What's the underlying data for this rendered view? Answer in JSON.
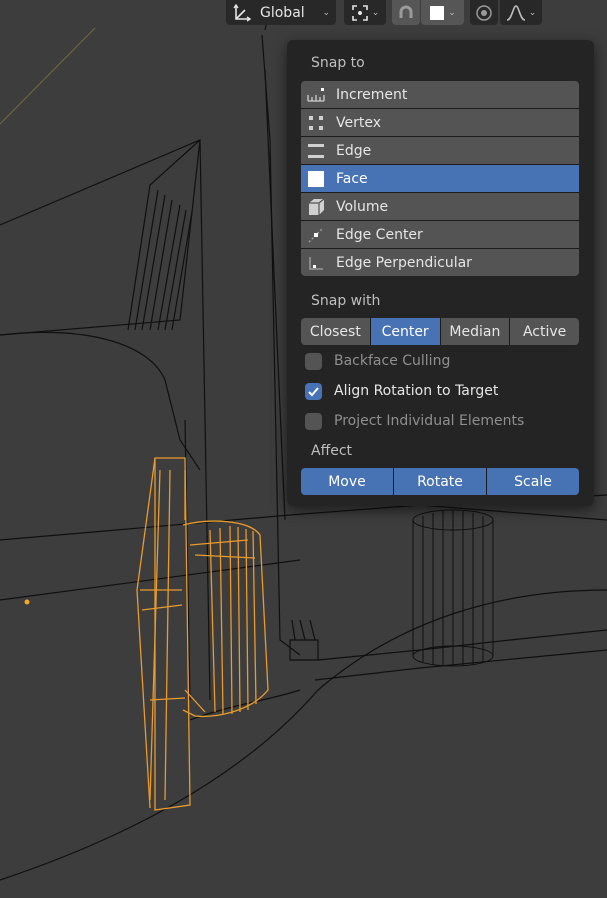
{
  "header": {
    "orientation_label": "Global",
    "snap_element_swatch_color": "#ffffff"
  },
  "snap_popover": {
    "snap_to_title": "Snap to",
    "snap_to_items": [
      {
        "label": "Increment",
        "icon": "increment-icon"
      },
      {
        "label": "Vertex",
        "icon": "vertex-icon"
      },
      {
        "label": "Edge",
        "icon": "edge-icon"
      },
      {
        "label": "Face",
        "icon": "face-icon"
      },
      {
        "label": "Volume",
        "icon": "volume-icon"
      },
      {
        "label": "Edge Center",
        "icon": "edge-center-icon"
      },
      {
        "label": "Edge Perpendicular",
        "icon": "edge-perpendicular-icon"
      }
    ],
    "snap_to_selected": "Face",
    "snap_with_title": "Snap with",
    "snap_with_options": [
      "Closest",
      "Center",
      "Median",
      "Active"
    ],
    "snap_with_selected": "Center",
    "options": [
      {
        "label": "Backface Culling",
        "checked": false
      },
      {
        "label": "Align Rotation to Target",
        "checked": true
      },
      {
        "label": "Project Individual Elements",
        "checked": false
      }
    ],
    "affect_title": "Affect",
    "affect_options": [
      "Move",
      "Rotate",
      "Scale"
    ],
    "affect_enabled": [
      true,
      true,
      true
    ]
  },
  "colors": {
    "accent": "#4772b3",
    "selected_object": "#e89b2e",
    "viewport_bg": "#3d3d3d",
    "popover_bg": "#242424",
    "button_bg": "#545454"
  }
}
